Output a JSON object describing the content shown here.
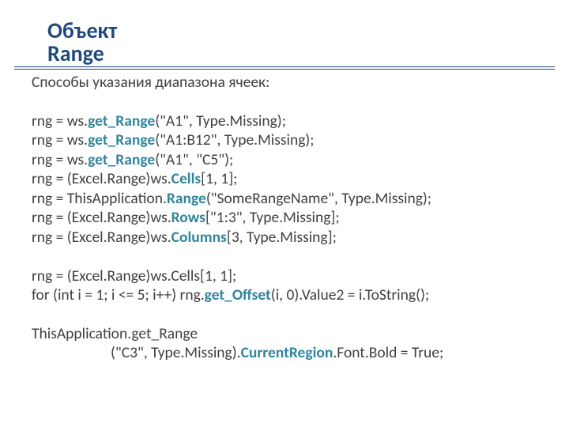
{
  "title_line1": "Объект",
  "title_line2": "Range",
  "intro": "Способы указания диапазона ячеек:",
  "l1a": "rng = ws.",
  "l1m": "get_Range",
  "l1b": "(\"A1\", Type.Missing);",
  "l2a": "rng = ws.",
  "l2m": "get_Range",
  "l2b": "(\"A1:B12\", Type.Missing);",
  "l3a": "rng = ws.",
  "l3m": "get_Range",
  "l3b": "(\"A1\", \"C5\");",
  "l4a": "rng = (Excel.Range)ws.",
  "l4m": "Cells",
  "l4b": "[1, 1];",
  "l5a": "rng = ThisApplication.",
  "l5m": "Range",
  "l5b": "(\"SomeRangeName\", Type.Missing);",
  "l6a": "rng = (Excel.Range)ws.",
  "l6m": "Rows",
  "l6b": "[\"1:3\", Type.Missing];",
  "l7a": "rng = (Excel.Range)ws.",
  "l7m": "Columns",
  "l7b": "[3, Type.Missing];",
  "l8": "rng = (Excel.Range)ws.Cells[1, 1];",
  "l9a": "for (int i = 1; i <= 5; i++)   rng.",
  "l9m": "get_Offset",
  "l9b": "(i, 0).Value2 = i.ToString();",
  "l10": "ThisApplication.get_Range",
  "l11a": "(\"C3\", Type.Missing).",
  "l11m": "CurrentRegion",
  "l11b": ".Font.Bold = True;"
}
